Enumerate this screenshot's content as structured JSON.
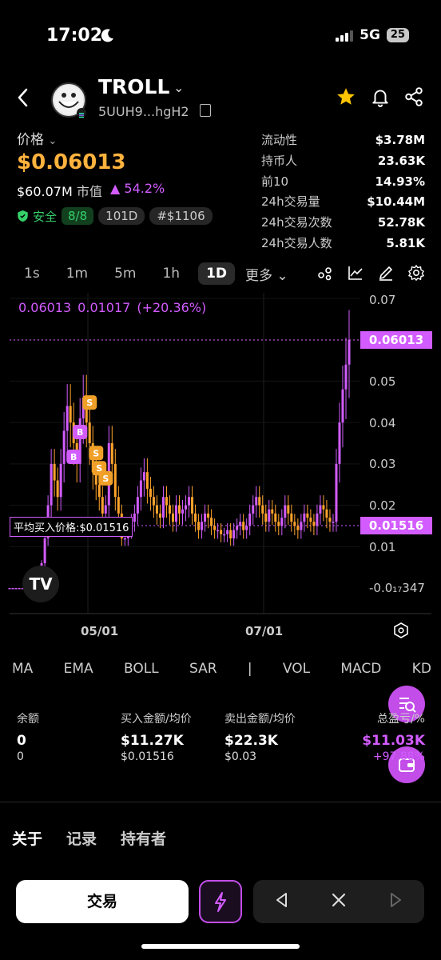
{
  "status": {
    "time": "17:02",
    "network": "5G",
    "battery": "25"
  },
  "token": {
    "name": "TROLL",
    "address": "5UUH9...hgH2"
  },
  "price": {
    "label": "价格",
    "value": "$0.06013",
    "market_cap": "$60.07M",
    "market_cap_label": "市值",
    "change": "54.2%"
  },
  "badges": {
    "safe_label": "安全",
    "safe_score": "8/8",
    "age": "101D",
    "rank": "#$1106"
  },
  "stats": [
    {
      "label": "流动性",
      "value": "$3.78M"
    },
    {
      "label": "持币人",
      "value": "23.63K"
    },
    {
      "label": "前10",
      "value": "14.93%"
    },
    {
      "label": "24h交易量",
      "value": "$10.44M"
    },
    {
      "label": "24h交易次数",
      "value": "52.78K"
    },
    {
      "label": "24h交易人数",
      "value": "5.81K"
    }
  ],
  "timeframes": [
    "1s",
    "1m",
    "5m",
    "1h",
    "1D"
  ],
  "timeframe_active": "1D",
  "timeframe_more": "更多",
  "chart_info": {
    "price": "0.06013",
    "change_abs": "0.01017",
    "change_pct": "(+20.36%)"
  },
  "chart_data": {
    "type": "candlestick",
    "y_ticks": [
      "0.07",
      "0.05",
      "0.04",
      "0.03",
      "0.02",
      "0.01",
      "-0.0₁₇347"
    ],
    "x_ticks": [
      "05/01",
      "07/01"
    ],
    "current_price_tag": "0.06013",
    "avg_price_tag": "0.01516",
    "avg_buy_label": "平均买入价格:$0.01516",
    "ylim": [
      -0.002,
      0.072
    ],
    "closes": [
      0,
      0,
      0,
      0,
      0,
      0,
      0,
      0,
      0,
      0.002,
      0.006,
      0.012,
      0.02,
      0.03,
      0.026,
      0.022,
      0.03,
      0.038,
      0.044,
      0.04,
      0.035,
      0.03,
      0.041,
      0.046,
      0.04,
      0.035,
      0.028,
      0.025,
      0.022,
      0.018,
      0.02,
      0.035,
      0.03,
      0.022,
      0.018,
      0.012,
      0.012,
      0.014,
      0.016,
      0.018,
      0.022,
      0.026,
      0.028,
      0.024,
      0.022,
      0.02,
      0.018,
      0.017,
      0.022,
      0.02,
      0.018,
      0.016,
      0.02,
      0.018,
      0.019,
      0.02,
      0.022,
      0.018,
      0.016,
      0.014,
      0.016,
      0.018,
      0.017,
      0.015,
      0.014,
      0.014,
      0.013,
      0.013,
      0.014,
      0.012,
      0.014,
      0.015,
      0.016,
      0.014,
      0.015,
      0.018,
      0.02,
      0.022,
      0.02,
      0.018,
      0.016,
      0.019,
      0.018,
      0.016,
      0.015,
      0.017,
      0.02,
      0.018,
      0.016,
      0.015,
      0.014,
      0.016,
      0.018,
      0.017,
      0.016,
      0.015,
      0.018,
      0.02,
      0.019,
      0.017,
      0.016,
      0.016,
      0.03,
      0.04,
      0.048,
      0.054,
      0.06
    ],
    "markers": [
      {
        "label": "S",
        "index": 25
      },
      {
        "label": "S",
        "index": 27
      },
      {
        "label": "S",
        "index": 28
      },
      {
        "label": "S",
        "index": 30
      },
      {
        "label": "B",
        "index": 20
      },
      {
        "label": "B",
        "index": 22
      }
    ],
    "colors": {
      "up": "#d25cff",
      "down": "#ffa32b"
    }
  },
  "indicators": [
    "MA",
    "EMA",
    "BOLL",
    "SAR",
    "|",
    "VOL",
    "MACD",
    "KD"
  ],
  "balance": {
    "label": "余额",
    "amount": "0",
    "sub": "0"
  },
  "buy": {
    "label": "买入金额/均价",
    "amount": "$11.27K",
    "avg": "$0.01516"
  },
  "sell": {
    "label": "卖出金额/均价",
    "amount": "$22.3K",
    "avg": "$0.03"
  },
  "pnl": {
    "label": "总盈亏/%",
    "amount": "$11.03K",
    "pct": "+97.88%"
  },
  "tabs": [
    "关于",
    "记录",
    "持有者"
  ],
  "trade_button": "交易"
}
